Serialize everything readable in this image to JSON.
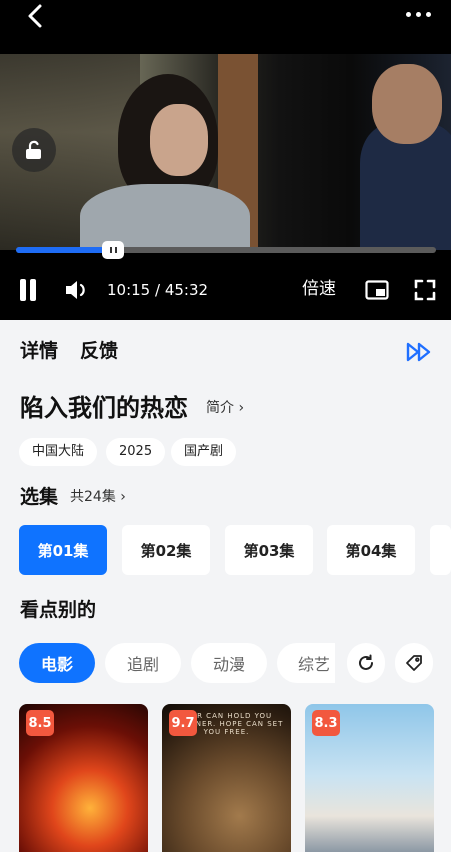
{
  "player": {
    "time_current": "10:15",
    "time_total": "45:32",
    "time_display": "10:15 / 45:32",
    "speed_label": "倍速",
    "progress_fraction": 0.23,
    "accent_color": "#1e6cf5"
  },
  "tabs": [
    {
      "label": "详情"
    },
    {
      "label": "反馈"
    }
  ],
  "show": {
    "title": "陷入我们的热恋",
    "intro_label": "简介 ›",
    "tags": [
      "中国大陆",
      "2025",
      "国产剧"
    ]
  },
  "episodes": {
    "section_title": "选集",
    "count_label": "共24集 ›",
    "items": [
      "第01集",
      "第02集",
      "第03集",
      "第04集"
    ],
    "active_index": 0
  },
  "discover": {
    "section_title": "看点别的",
    "categories": [
      "电影",
      "追剧",
      "动漫",
      "综艺"
    ],
    "active_index": 0,
    "posters": [
      {
        "score": "8.5"
      },
      {
        "score": "9.7",
        "caption": "FEAR CAN HOLD YOU PRISONER. HOPE CAN SET YOU FREE."
      },
      {
        "score": "8.3"
      }
    ]
  },
  "icons": {
    "back": "back-icon",
    "more": "more-icon",
    "lock": "unlock-icon",
    "pause": "pause-icon",
    "volume": "volume-icon",
    "pip": "picture-in-picture-icon",
    "fullscreen": "fullscreen-icon",
    "skip": "fast-forward-icon",
    "refresh": "refresh-icon",
    "tag": "tag-icon"
  },
  "colors": {
    "primary": "#0f73ff",
    "score_badge": "#f2583e"
  }
}
